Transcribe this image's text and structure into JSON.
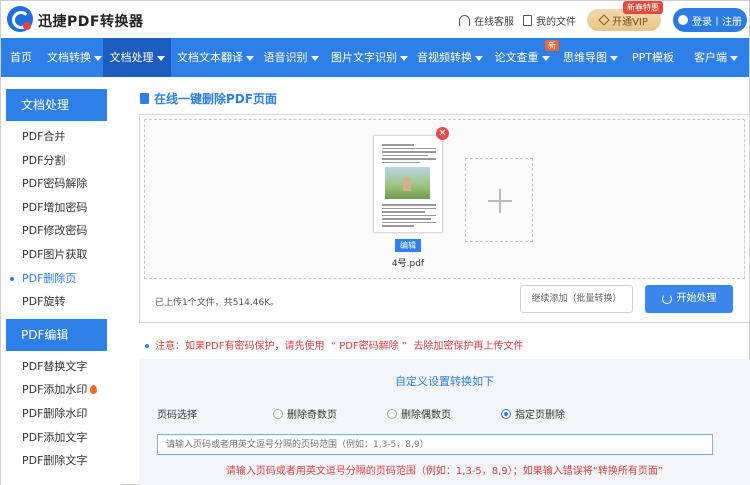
{
  "header": {
    "brand": "迅捷PDF转换器",
    "service": "在线客服",
    "my_files": "我的文件",
    "vip": "开通VIP",
    "vip_badge": "新春特惠",
    "login": "登录丨注册"
  },
  "nav": {
    "items": [
      {
        "label": "首页",
        "caret": false
      },
      {
        "label": "文档转换",
        "caret": true
      },
      {
        "label": "文档处理",
        "caret": true,
        "active": true
      },
      {
        "label": "文档文本翻译",
        "caret": true
      },
      {
        "label": "语音识别",
        "caret": true
      },
      {
        "label": "图片文字识别",
        "caret": true
      },
      {
        "label": "音视频转换",
        "caret": true
      },
      {
        "label": "论文查重",
        "caret": true,
        "badge": "新"
      },
      {
        "label": "思维导图",
        "caret": true
      },
      {
        "label": "PPT模板",
        "caret": false
      },
      {
        "label": "客户端",
        "caret": true
      }
    ]
  },
  "sidebar": {
    "section1_title": "文档处理",
    "section1_items": [
      "PDF合并",
      "PDF分割",
      "PDF密码解除",
      "PDF增加密码",
      "PDF修改密码",
      "PDF图片获取",
      "PDF删除页",
      "PDF旋转"
    ],
    "section1_active": "PDF删除页",
    "section2_title": "PDF编辑",
    "section2_items": [
      "PDF替换文字",
      "PDF添加水印",
      "PDF删除水印",
      "PDF添加文字",
      "PDF删除文字"
    ]
  },
  "main": {
    "title": "在线一键删除PDF页面",
    "file": {
      "name": "4号.pdf",
      "edit_label": "编辑",
      "delete_glyph": "✕"
    },
    "upload_info": "已上传1个文件，共514.46K。",
    "continue_button": "继续添加（批量转换）",
    "start_button": "开始处理",
    "notice_prefix": "注意：如果PDF有密码保护，请先使用",
    "notice_link": "“ PDF密码解除 ”",
    "notice_suffix": "去除加密保护再上传文件",
    "settings": {
      "title": "自定义设置转换如下",
      "range_label": "页码选择",
      "options": [
        "删除奇数页",
        "删除偶数页",
        "指定页删除"
      ],
      "selected": "指定页删除",
      "input_placeholder": "请输入页码或者用英文逗号分隔的页码范围（例如：1,3-5，8,9）",
      "hint": "请输入页码或者用英文逗号分隔的页码范围（例如：1,3-5，8,9）；如果输入错误将“转换所有页面”"
    }
  },
  "colors": {
    "primary": "#2f7fe8",
    "nav_active": "#1c5cbf",
    "warning": "#e04040"
  }
}
